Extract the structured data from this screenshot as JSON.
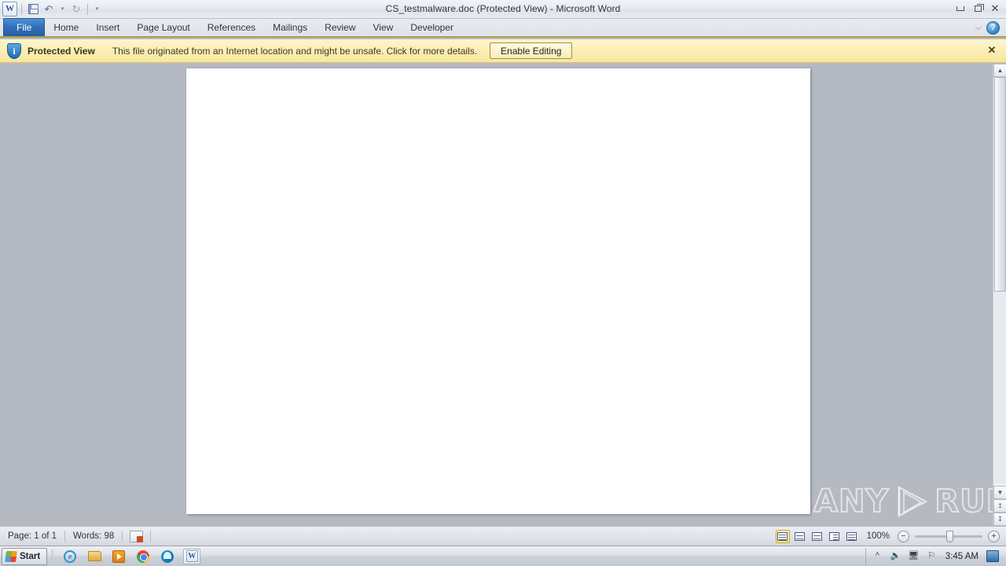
{
  "window": {
    "title": "CS_testmalware.doc (Protected View)  -  Microsoft Word",
    "minimize_label": "Minimize",
    "restore_label": "Restore Down",
    "close_label": "Close"
  },
  "quick_access": {
    "app_icon": "word-icon",
    "app_glyph": "W",
    "items": [
      {
        "name": "save-icon",
        "label": "Save"
      },
      {
        "name": "undo-icon",
        "label": "Undo",
        "glyph": "↶"
      },
      {
        "name": "undo-dropdown-icon",
        "label": "Undo options",
        "glyph": "▾"
      },
      {
        "name": "redo-icon",
        "label": "Redo",
        "glyph": "↻"
      },
      {
        "name": "customize-qat-icon",
        "label": "Customize Quick Access Toolbar",
        "glyph": "▾"
      }
    ]
  },
  "ribbon": {
    "tabs": [
      {
        "label": "File",
        "active": true
      },
      {
        "label": "Home",
        "active": false
      },
      {
        "label": "Insert",
        "active": false
      },
      {
        "label": "Page Layout",
        "active": false
      },
      {
        "label": "References",
        "active": false
      },
      {
        "label": "Mailings",
        "active": false
      },
      {
        "label": "Review",
        "active": false
      },
      {
        "label": "View",
        "active": false
      },
      {
        "label": "Developer",
        "active": false
      }
    ],
    "collapse_glyph": "⌵",
    "help_glyph": "?"
  },
  "protected_view": {
    "shield_glyph": "i",
    "title": "Protected View",
    "message": "This file originated from an Internet location and might be unsafe. Click for more details.",
    "enable_button": "Enable Editing",
    "close_glyph": "✕",
    "bar_color": "#faeeb0"
  },
  "document": {
    "page_background": "#ffffff",
    "canvas_color": "#b5b9c2",
    "watermark": {
      "left_text": "ANY",
      "right_text": "RUN",
      "logo": "play-triangle-logo"
    }
  },
  "scrollbar": {
    "up_glyph": "▲",
    "down_glyph": "▼",
    "prev_page_glyph": "↥",
    "next_page_glyph": "↧"
  },
  "status_bar": {
    "page": "Page: 1 of 1",
    "words": "Words: 98",
    "proofing_icon": "proofing-errors-icon",
    "views": [
      {
        "name": "print-layout-view",
        "label": "Print Layout",
        "active": true
      },
      {
        "name": "full-screen-reading-view",
        "label": "Full Screen Reading",
        "active": false
      },
      {
        "name": "web-layout-view",
        "label": "Web Layout",
        "active": false
      },
      {
        "name": "outline-view",
        "label": "Outline",
        "active": false
      },
      {
        "name": "draft-view",
        "label": "Draft",
        "active": false
      }
    ],
    "zoom": "100%",
    "zoom_out_glyph": "−",
    "zoom_in_glyph": "+"
  },
  "taskbar": {
    "start_label": "Start",
    "items": [
      {
        "name": "taskbar-internet-explorer",
        "label": "Internet Explorer",
        "active": false
      },
      {
        "name": "taskbar-windows-explorer",
        "label": "Windows Explorer",
        "active": false
      },
      {
        "name": "taskbar-media-player",
        "label": "Windows Media Player",
        "active": false
      },
      {
        "name": "taskbar-chrome",
        "label": "Google Chrome",
        "active": false
      },
      {
        "name": "taskbar-edge",
        "label": "Microsoft Edge",
        "active": false
      },
      {
        "name": "taskbar-word",
        "label": "Microsoft Word",
        "active": true,
        "glyph": "W"
      }
    ],
    "tray": [
      {
        "name": "show-hidden-icons-icon",
        "glyph": "«"
      },
      {
        "name": "volume-icon",
        "glyph": "ᐧ)"
      },
      {
        "name": "network-icon",
        "glyph": "▣"
      },
      {
        "name": "action-center-flag-icon",
        "glyph": "⚐"
      }
    ],
    "time": "3:45 AM",
    "show_desktop": "show-desktop-button"
  }
}
